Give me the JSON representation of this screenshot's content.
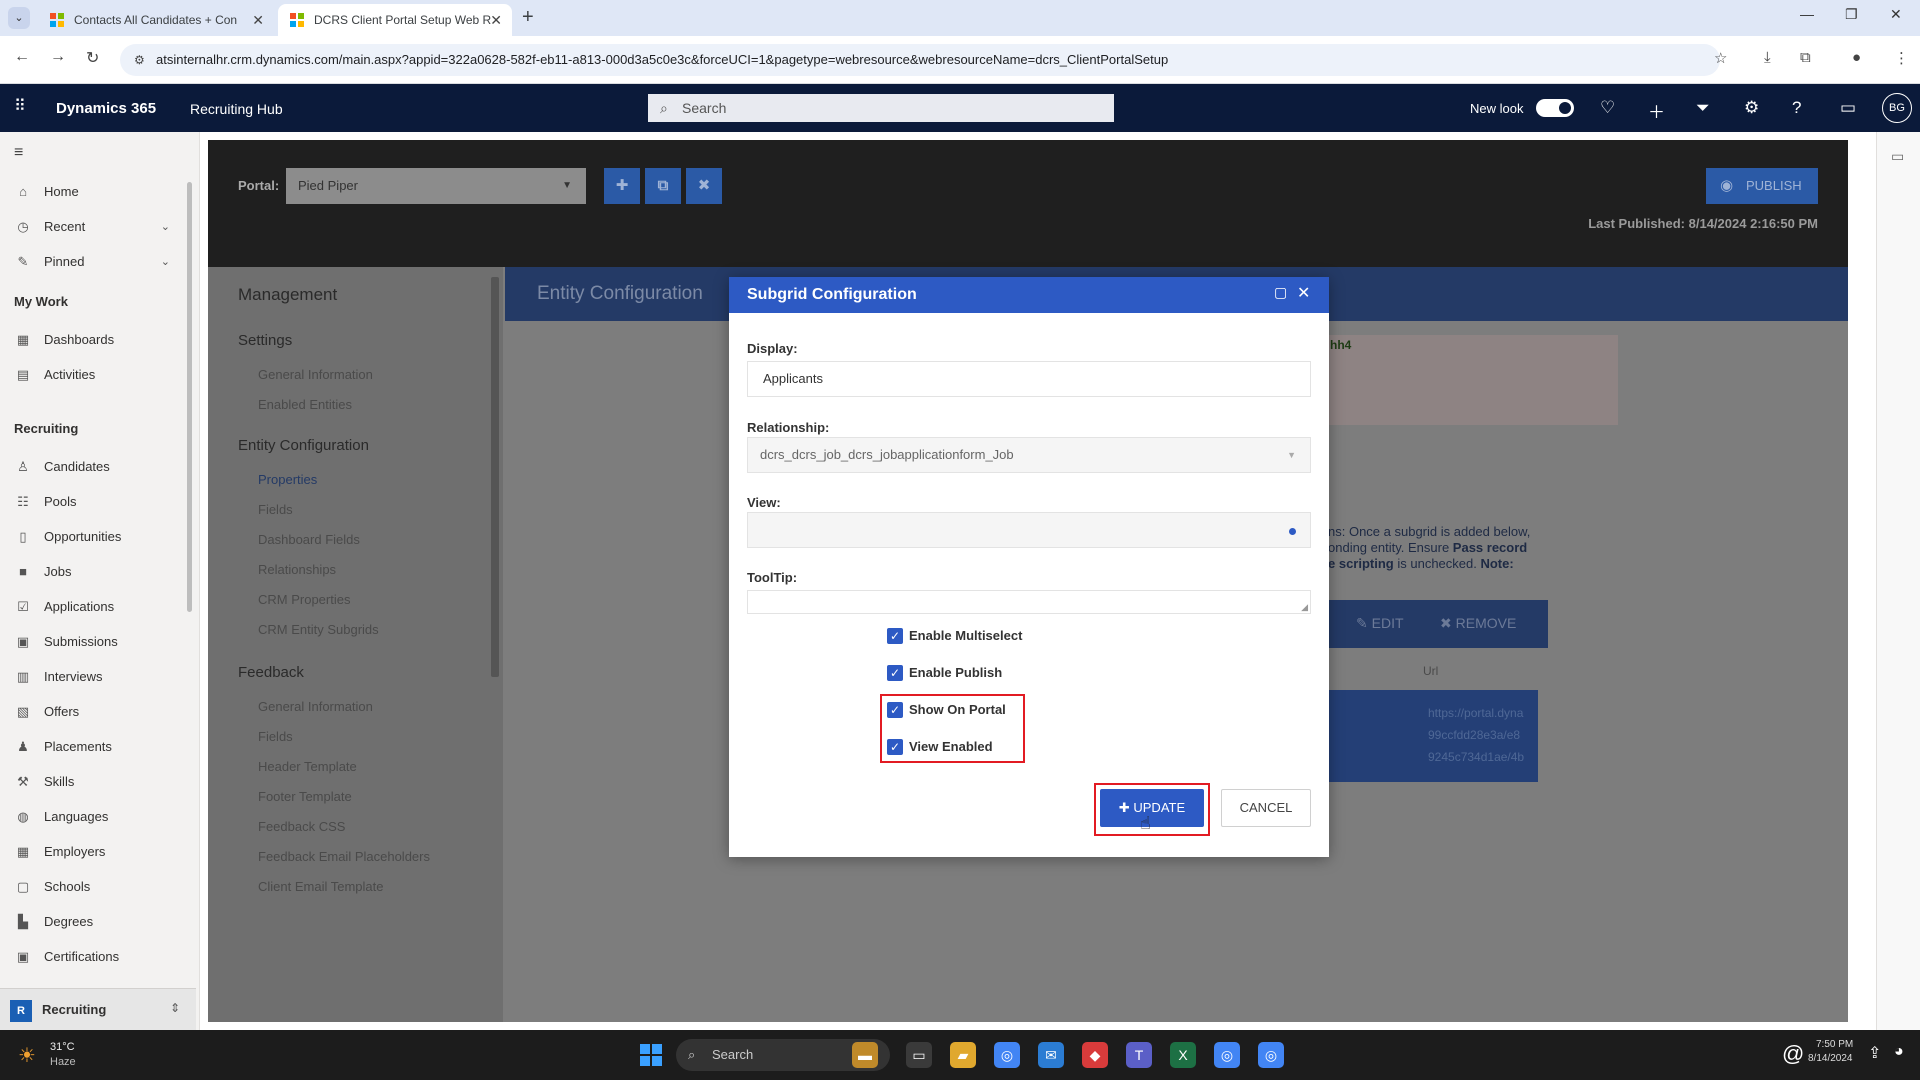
{
  "browser": {
    "tabs": [
      {
        "title": "Contacts All Candidates + Con",
        "active": false
      },
      {
        "title": "DCRS Client Portal Setup Web R",
        "active": true
      }
    ],
    "url": "atsinternalhr.crm.dynamics.com/main.aspx?appid=322a0628-582f-eb11-a813-000d3a5c0e3c&forceUCI=1&pagetype=webresource&webresourceName=dcrs_ClientPortalSetup"
  },
  "header": {
    "brand": "Dynamics 365",
    "app_name": "Recruiting Hub",
    "search_placeholder": "Search",
    "new_look_label": "New look",
    "new_look_on": true,
    "user_initials": "BG"
  },
  "sitemap": {
    "top": [
      {
        "label": "Home",
        "icon": "home-icon"
      },
      {
        "label": "Recent",
        "icon": "clock-icon"
      },
      {
        "label": "Pinned",
        "icon": "pin-icon"
      }
    ],
    "my_work_title": "My Work",
    "my_work": [
      {
        "label": "Dashboards",
        "icon": "dashboard-icon"
      },
      {
        "label": "Activities",
        "icon": "clipboard-icon"
      }
    ],
    "recruiting_title": "Recruiting",
    "recruiting": [
      {
        "label": "Candidates",
        "icon": "person-icon"
      },
      {
        "label": "Pools",
        "icon": "group-icon"
      },
      {
        "label": "Opportunities",
        "icon": "document-icon"
      },
      {
        "label": "Jobs",
        "icon": "briefcase-icon"
      },
      {
        "label": "Applications",
        "icon": "checklist-icon"
      },
      {
        "label": "Submissions",
        "icon": "id-card-icon"
      },
      {
        "label": "Interviews",
        "icon": "calendar-icon"
      },
      {
        "label": "Offers",
        "icon": "doc-edit-icon"
      },
      {
        "label": "Placements",
        "icon": "people-icon"
      },
      {
        "label": "Skills",
        "icon": "tools-icon"
      },
      {
        "label": "Languages",
        "icon": "globe-icon"
      },
      {
        "label": "Employers",
        "icon": "building-icon"
      },
      {
        "label": "Schools",
        "icon": "abc-icon"
      },
      {
        "label": "Degrees",
        "icon": "book-icon"
      },
      {
        "label": "Certifications",
        "icon": "certificate-icon"
      }
    ],
    "area": {
      "badge": "R",
      "label": "Recruiting"
    }
  },
  "portal": {
    "label": "Portal:",
    "selected": "Pied Piper",
    "publish_label": "PUBLISH",
    "last_published_label": "Last Published:",
    "last_published_value": "8/14/2024 2:16:50 PM"
  },
  "left_nav": {
    "title": "Management",
    "settings_title": "Settings",
    "settings": [
      "General Information",
      "Enabled Entities"
    ],
    "entity_title": "Entity Configuration",
    "entity": [
      "Properties",
      "Fields",
      "Dashboard Fields",
      "Relationships",
      "CRM Properties",
      "CRM Entity Subgrids"
    ],
    "feedback_title": "Feedback",
    "feedback": [
      "General Information",
      "Fields",
      "Header Template",
      "Footer Template",
      "Feedback CSS",
      "Feedback Email Placeholders",
      "Client Email Template"
    ]
  },
  "entity_panel": {
    "title": "Entity Configuration",
    "fragment": "hh4",
    "note_1": "ns: Once a subgrid is added below,",
    "note_2": "onding entity. Ensure ",
    "note_bold_2": "Pass record",
    "note_bold_3": "e scripting",
    "note_3": " is unchecked. ",
    "note_bold_4": "Note:",
    "edit_label": "EDIT",
    "remove_label": "REMOVE",
    "col_url": "Url",
    "url_lines": [
      "https://portal.dyna",
      "99ccfdd28e3a/e8",
      "9245c734d1ae/4b"
    ]
  },
  "modal": {
    "title": "Subgrid Configuration",
    "display_label": "Display:",
    "display_value": "Applicants",
    "relationship_label": "Relationship:",
    "relationship_value": "dcrs_dcrs_job_dcrs_jobapplicationform_Job",
    "view_label": "View:",
    "view_value": "",
    "tooltip_label": "ToolTip:",
    "tooltip_value": "",
    "checkboxes": [
      {
        "label": "Enable Multiselect",
        "checked": true
      },
      {
        "label": "Enable Publish",
        "checked": true
      },
      {
        "label": "Show On Portal",
        "checked": true
      },
      {
        "label": "View Enabled",
        "checked": true
      }
    ],
    "update_label": "UPDATE",
    "cancel_label": "CANCEL"
  },
  "taskbar": {
    "weather_temp": "31°C",
    "weather_desc": "Haze",
    "search_label": "Search",
    "time": "7:50 PM",
    "date": "8/14/2024"
  },
  "colors": {
    "modal_header": "#2d5ac4",
    "d365_header": "#0b1a3a",
    "highlight": "#e21b23"
  }
}
